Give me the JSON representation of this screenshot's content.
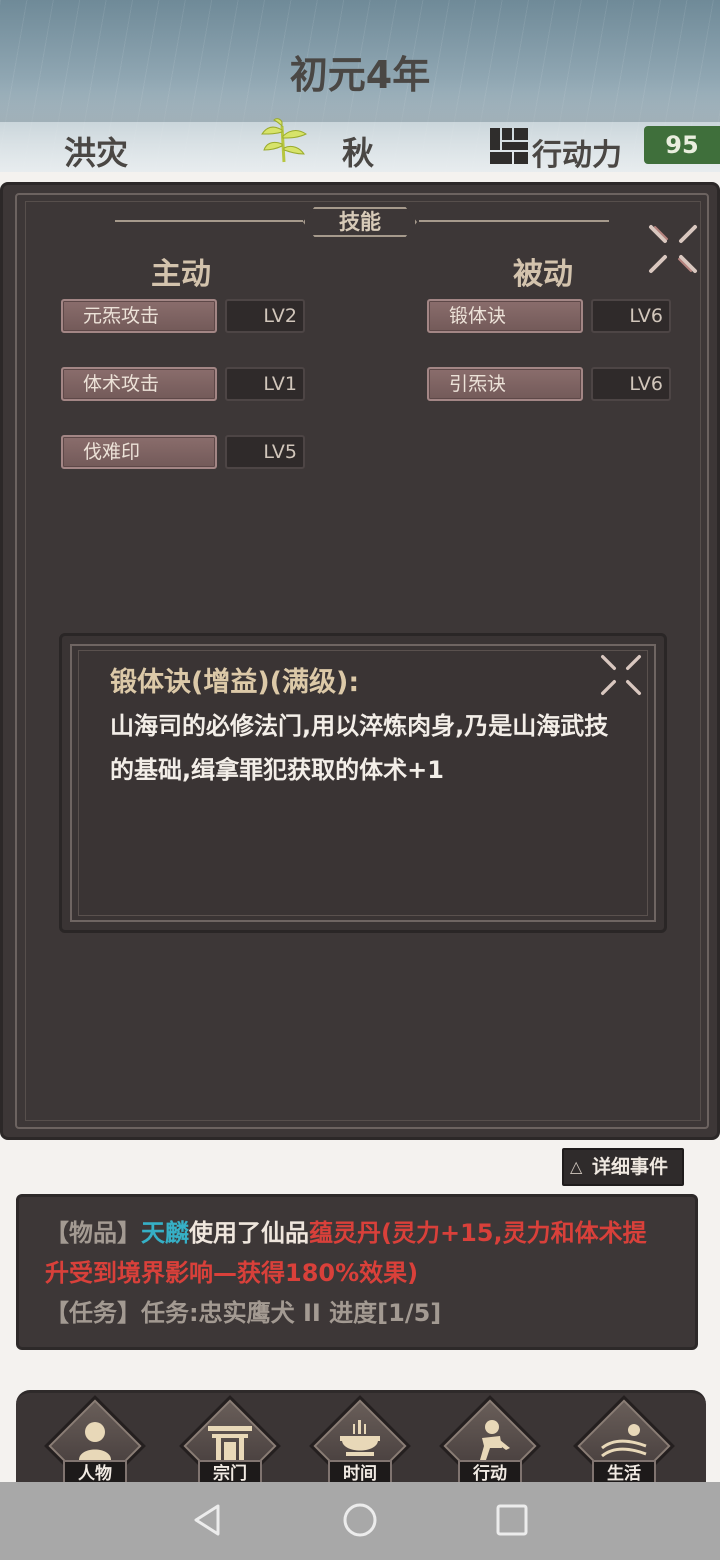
{
  "header": {
    "year": "初元4年",
    "disaster": "洪灾",
    "season": "秋",
    "season_icon": "bamboo-leaf-icon",
    "action_points_label": "行动力",
    "action_points_value": "95",
    "action_points_icon": "wall-blocks-icon"
  },
  "skills_panel": {
    "title": "技能",
    "active_header": "主动",
    "passive_header": "被动",
    "active_skills": [
      {
        "name": "元炁攻击",
        "level": "LV2"
      },
      {
        "name": "体术攻击",
        "level": "LV1"
      },
      {
        "name": "伐难印",
        "level": "LV5"
      }
    ],
    "passive_skills": [
      {
        "name": "锻体诀",
        "level": "LV6"
      },
      {
        "name": "引炁诀",
        "level": "LV6"
      }
    ]
  },
  "skill_detail": {
    "title": "锻体诀(增益)(满级):",
    "description": "山海司的必修法门,用以淬炼肉身,乃是山海武技的基础,缉拿罪犯获取的体术+1"
  },
  "event_log": {
    "detail_button": "详细事件",
    "line1_tag": "【物品】",
    "line1_actor": "天麟",
    "line1_text": "使用了仙品",
    "line1_item": "蕴灵丹",
    "line1_effect": "(灵力+15,灵力和体术提升受到境界影响—获得180%效果)",
    "line2_tag": "【任务】",
    "line2_text": "任务:忠实鹰犬 II 进度[1/5]"
  },
  "bottom_nav": [
    {
      "label": "人物",
      "icon": "person-icon"
    },
    {
      "label": "宗门",
      "icon": "sect-gate-icon"
    },
    {
      "label": "时间",
      "icon": "incense-burner-icon"
    },
    {
      "label": "行动",
      "icon": "action-figure-icon"
    },
    {
      "label": "生活",
      "icon": "landscape-icon"
    }
  ],
  "colors": {
    "panel_bg": "#3d3737",
    "skill_button": "#7e6362",
    "ap_badge": "#3f6f3b",
    "highlight_cyan": "#36b0c6",
    "highlight_red": "#d9403a",
    "detail_title": "#dcc9a8"
  }
}
